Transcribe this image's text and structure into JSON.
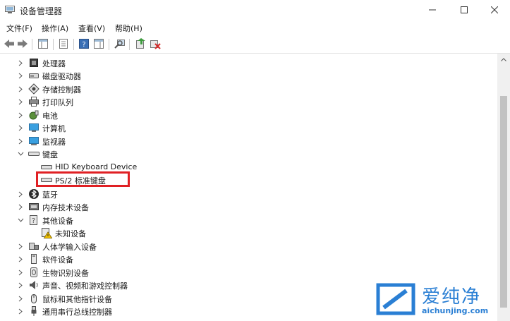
{
  "window": {
    "title": "设备管理器"
  },
  "menu": [
    {
      "label": "文件(F)"
    },
    {
      "label": "操作(A)"
    },
    {
      "label": "查看(V)"
    },
    {
      "label": "帮助(H)"
    }
  ],
  "tree": {
    "processors": "处理器",
    "disk_drives": "磁盘驱动器",
    "storage_controllers": "存储控制器",
    "print_queues": "打印队列",
    "batteries": "电池",
    "computer": "计算机",
    "monitors": "监视器",
    "keyboards": "键盘",
    "hid_keyboard": "HID Keyboard Device",
    "ps2_keyboard": "PS/2 标准键盘",
    "bluetooth": "蓝牙",
    "memory_tech": "内存技术设备",
    "other_devices": "其他设备",
    "unknown_device": "未知设备",
    "hid": "人体学输入设备",
    "software_devices": "软件设备",
    "biometric": "生物识别设备",
    "sound": "声音、视频和游戏控制器",
    "mice": "鼠标和其他指针设备",
    "usb": "通用串行总线控制器"
  },
  "watermark": {
    "brand": "爱纯净",
    "url": "aichunjing.com"
  },
  "colors": {
    "highlight": "#e02024",
    "brand": "#2a7fd4"
  }
}
